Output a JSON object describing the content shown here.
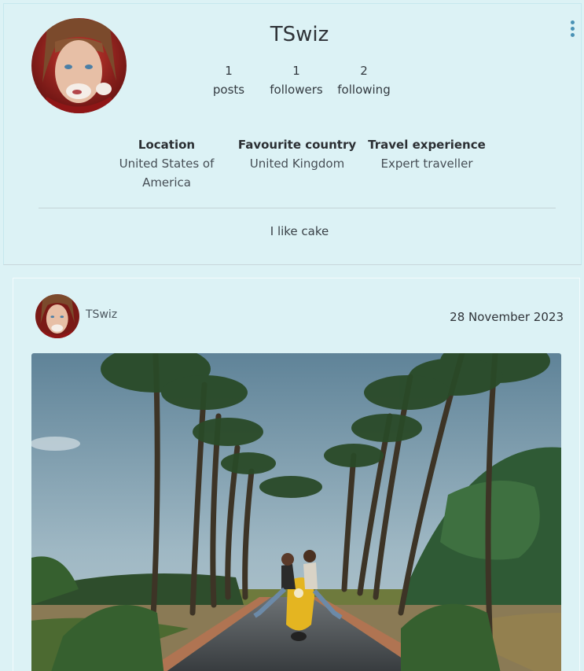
{
  "profile": {
    "username": "TSwiz",
    "stats": [
      {
        "count": "1",
        "label": "posts"
      },
      {
        "count": "1",
        "label": "followers"
      },
      {
        "count": "2",
        "label": "following"
      }
    ],
    "details": [
      {
        "label": "Location",
        "value": "United States of America"
      },
      {
        "label": "Favourite country",
        "value": "United Kingdom"
      },
      {
        "label": "Travel experience",
        "value": "Expert traveller"
      }
    ],
    "bio": "I like cake",
    "menu_icon": "kebab-menu-icon"
  },
  "post": {
    "author": "TSwiz",
    "date": "28 November 2023"
  },
  "colors": {
    "background": "#dcf2f5",
    "accent": "#4a92b5"
  }
}
